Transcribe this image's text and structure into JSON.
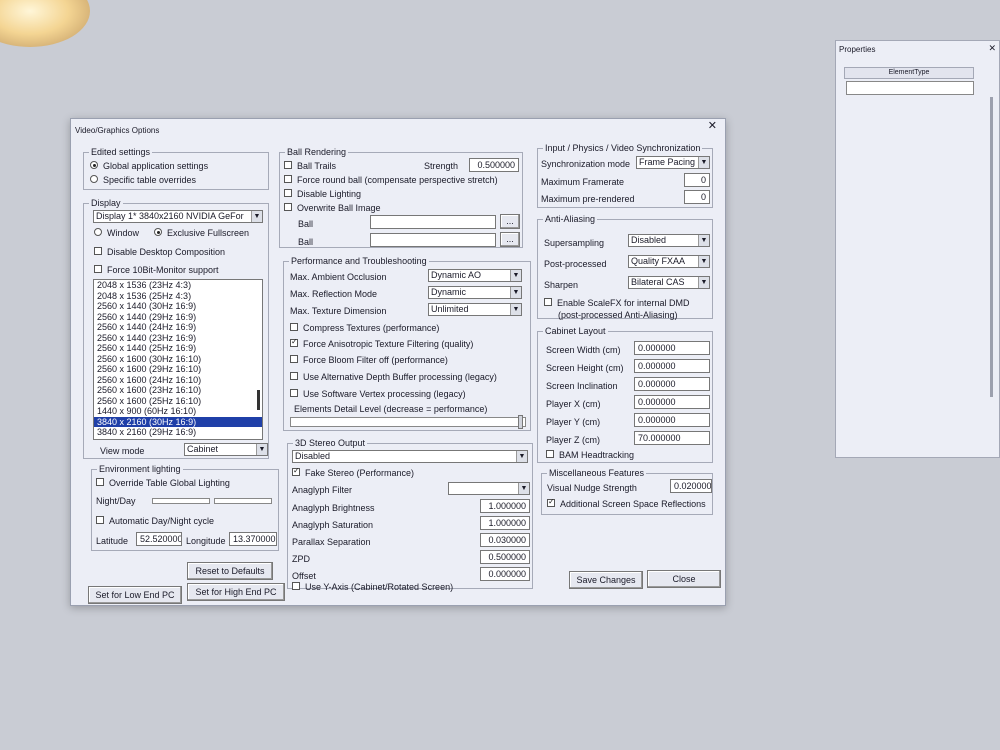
{
  "dialog": {
    "title": "Video/Graphics Options",
    "close": "✕"
  },
  "edited": {
    "title": "Edited settings",
    "global": "Global application settings",
    "specific": "Specific table overrides"
  },
  "display": {
    "title": "Display",
    "device": "Display 1* 3840x2160 NVIDIA GeFor",
    "window": "Window",
    "exclusive": "Exclusive Fullscreen",
    "disable_comp": "Disable Desktop Composition",
    "force10": "Force 10Bit-Monitor support",
    "modes": [
      "2048 x 1536 (23Hz 4:3)",
      "2048 x 1536 (25Hz 4:3)",
      "2560 x 1440 (30Hz 16:9)",
      "2560 x 1440 (29Hz 16:9)",
      "2560 x 1440 (24Hz 16:9)",
      "2560 x 1440 (23Hz 16:9)",
      "2560 x 1440 (25Hz 16:9)",
      "2560 x 1600 (30Hz 16:10)",
      "2560 x 1600 (29Hz 16:10)",
      "2560 x 1600 (24Hz 16:10)",
      "2560 x 1600 (23Hz 16:10)",
      "2560 x 1600 (25Hz 16:10)",
      "1440 x 900 (60Hz 16:10)",
      "3840 x 2160 (30Hz 16:9)",
      "3840 x 2160 (29Hz 16:9)"
    ],
    "view_mode_label": "View mode",
    "view_mode": "Cabinet"
  },
  "env": {
    "title": "Environment lighting",
    "override": "Override Table Global Lighting",
    "nightday": "Night/Day",
    "auto": "Automatic Day/Night cycle",
    "lat_label": "Latitude",
    "lat": "52.520000",
    "lon_label": "Longitude",
    "lon": "13.370000"
  },
  "buttons": {
    "reset": "Reset to Defaults",
    "low": "Set for Low End PC",
    "high": "Set for High End PC",
    "save": "Save Changes",
    "close": "Close"
  },
  "ball": {
    "title": "Ball Rendering",
    "trails": "Ball Trails",
    "strength_label": "Strength",
    "strength": "0.500000",
    "round": "Force round ball (compensate perspective stretch)",
    "lighting": "Disable Lighting",
    "overwrite": "Overwrite Ball Image",
    "ball1": "Ball",
    "ball2": "Ball",
    "dots": "..."
  },
  "perf": {
    "title": "Performance and Troubleshooting",
    "ao_label": "Max. Ambient Occlusion",
    "ao": "Dynamic AO",
    "refl_label": "Max. Reflection Mode",
    "refl": "Dynamic",
    "tex_label": "Max. Texture Dimension",
    "tex": "Unlimited",
    "compress": "Compress Textures (performance)",
    "aniso": "Force Anisotropic Texture Filtering (quality)",
    "bloom": "Force Bloom Filter off (performance)",
    "depth": "Use Alternative Depth Buffer processing (legacy)",
    "vertex": "Use Software Vertex processing (legacy)",
    "detail": "Elements Detail Level (decrease = performance)"
  },
  "stereo": {
    "title": "3D Stereo Output",
    "mode": "Disabled",
    "fake": "Fake Stereo (Performance)",
    "filter": "Anaglyph Filter",
    "brightness_label": "Anaglyph Brightness",
    "brightness": "1.000000",
    "saturation_label": "Anaglyph Saturation",
    "saturation": "1.000000",
    "parallax_label": "Parallax Separation",
    "parallax": "0.030000",
    "zpd_label": "ZPD",
    "zpd": "0.500000",
    "offset_label": "Offset",
    "offset": "0.000000",
    "yaxis": "Use Y-Axis (Cabinet/Rotated Screen)"
  },
  "sync": {
    "title": "Input / Physics / Video Synchronization",
    "mode_label": "Synchronization mode",
    "mode": "Frame Pacing",
    "maxfr_label": "Maximum Framerate",
    "maxfr": "0",
    "maxpre_label": "Maximum pre-rendered",
    "maxpre": "0"
  },
  "aa": {
    "title": "Anti-Aliasing",
    "ss_label": "Supersampling",
    "ss": "Disabled",
    "pp_label": "Post-processed",
    "pp": "Quality FXAA",
    "sharpen_label": "Sharpen",
    "sharpen": "Bilateral CAS",
    "scalefx": "Enable ScaleFX for internal DMD",
    "scalefx2": "(post-processed Anti-Aliasing)"
  },
  "cab": {
    "title": "Cabinet Layout",
    "sw_label": "Screen Width (cm)",
    "sw": "0.000000",
    "sh_label": "Screen Height (cm)",
    "sh": "0.000000",
    "si_label": "Screen Inclination",
    "si": "0.000000",
    "px_label": "Player X (cm)",
    "px": "0.000000",
    "py_label": "Player Y (cm)",
    "py": "0.000000",
    "pz_label": "Player Z (cm)",
    "pz": "70.000000",
    "bam": "BAM Headtracking"
  },
  "misc": {
    "title": "Miscellaneous Features",
    "nudge_label": "Visual Nudge Strength",
    "nudge": "0.020000",
    "ssr": "Additional Screen Space Reflections"
  },
  "props": {
    "title": "Properties",
    "col": "ElementType",
    "close": "✕"
  }
}
